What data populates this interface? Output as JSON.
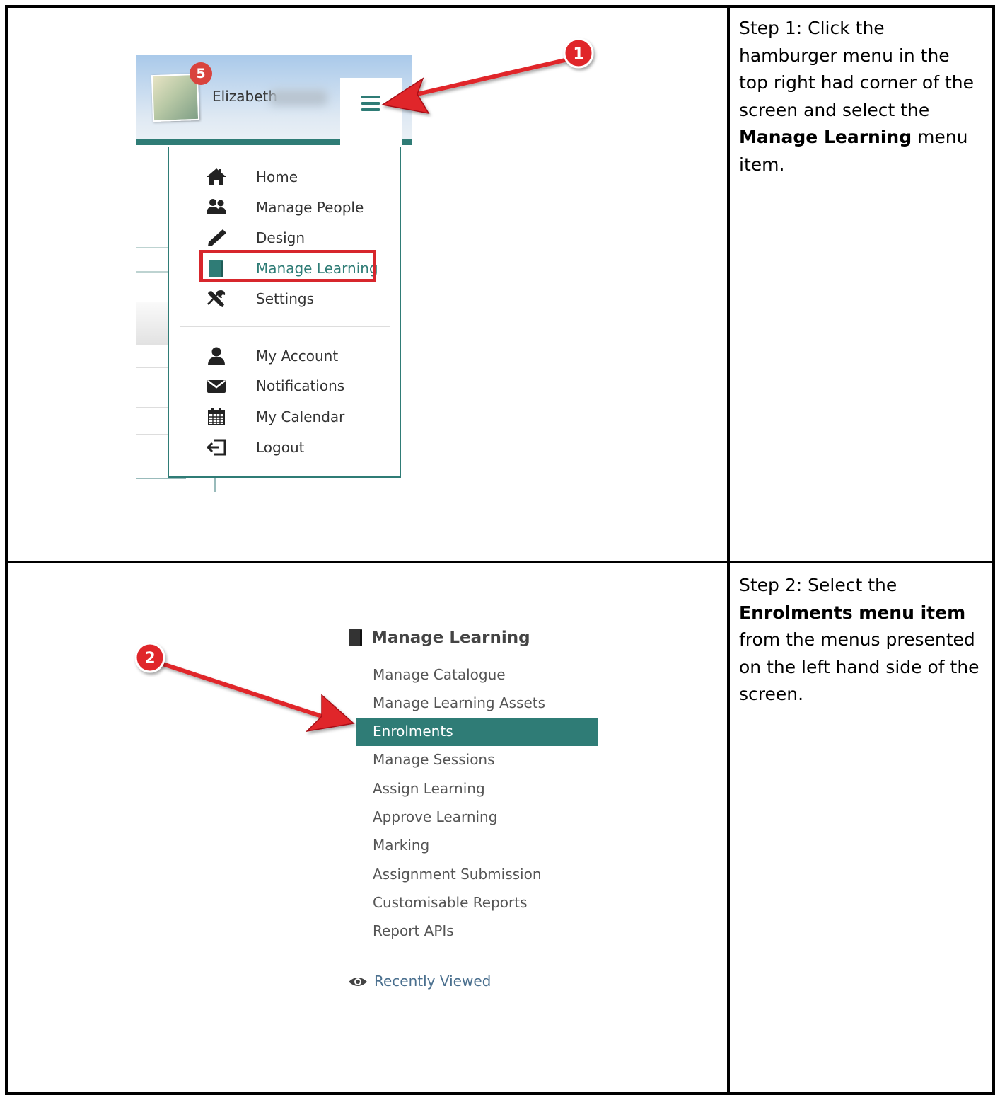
{
  "step1": {
    "text_before": "Step 1: Click the hamburger menu in the top right had corner of the screen and select the ",
    "text_bold": "Manage Learning",
    "text_after": "  menu item."
  },
  "step2": {
    "text_before": "Step 2: Select the ",
    "text_bold": "Enrolments menu item",
    "text_after": " from the menus presented on the left hand side of the screen."
  },
  "panel1": {
    "notification_count": "5",
    "user_name": "Elizabeth",
    "callout_number": "1",
    "menu_items": [
      {
        "label": "Home",
        "icon": "home-icon"
      },
      {
        "label": "Manage People",
        "icon": "people-icon"
      },
      {
        "label": "Design",
        "icon": "pencil-icon"
      },
      {
        "label": "Manage Learning",
        "icon": "book-icon"
      },
      {
        "label": "Settings",
        "icon": "tools-icon"
      },
      {
        "label": "My Account",
        "icon": "user-icon"
      },
      {
        "label": "Notifications",
        "icon": "envelope-icon"
      },
      {
        "label": "My Calendar",
        "icon": "calendar-icon"
      },
      {
        "label": "Logout",
        "icon": "logout-icon"
      }
    ]
  },
  "panel2": {
    "callout_number": "2",
    "section_title": "Manage Learning",
    "items": [
      "Manage Catalogue",
      "Manage Learning Assets",
      "Enrolments",
      "Manage Sessions",
      "Assign Learning",
      "Approve Learning",
      "Marking",
      "Assignment Submission",
      "Customisable Reports",
      "Report APIs"
    ],
    "recently_viewed": "Recently Viewed"
  },
  "colors": {
    "teal": "#2f7c76",
    "highlight_red": "#d7262c",
    "arrow_red": "#e0262c",
    "badge_red": "#d9433d"
  }
}
